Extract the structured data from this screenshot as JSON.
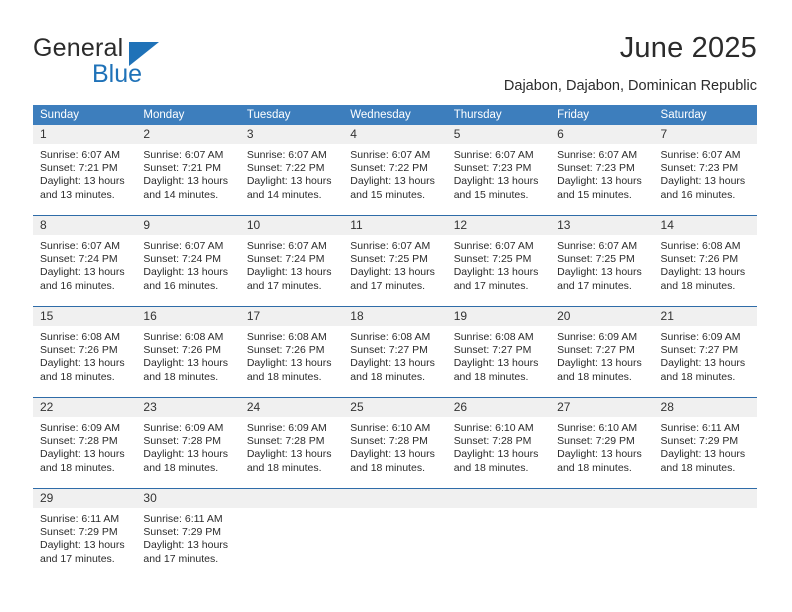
{
  "brand": {
    "name_part1": "General",
    "name_part2": "Blue",
    "accent_color": "#1f72b8",
    "triangle_icon": "triangle-icon"
  },
  "header": {
    "title": "June 2025",
    "subtitle": "Dajabon, Dajabon, Dominican Republic"
  },
  "calendar": {
    "header_bg": "#3d7ebd",
    "daynum_band_bg": "#f0f0f0",
    "row_divider_color": "#2f6ca8",
    "columns": [
      "Sunday",
      "Monday",
      "Tuesday",
      "Wednesday",
      "Thursday",
      "Friday",
      "Saturday"
    ],
    "weeks": [
      [
        {
          "day": "1",
          "sunrise": "Sunrise: 6:07 AM",
          "sunset": "Sunset: 7:21 PM",
          "daylight": "Daylight: 13 hours and 13 minutes."
        },
        {
          "day": "2",
          "sunrise": "Sunrise: 6:07 AM",
          "sunset": "Sunset: 7:21 PM",
          "daylight": "Daylight: 13 hours and 14 minutes."
        },
        {
          "day": "3",
          "sunrise": "Sunrise: 6:07 AM",
          "sunset": "Sunset: 7:22 PM",
          "daylight": "Daylight: 13 hours and 14 minutes."
        },
        {
          "day": "4",
          "sunrise": "Sunrise: 6:07 AM",
          "sunset": "Sunset: 7:22 PM",
          "daylight": "Daylight: 13 hours and 15 minutes."
        },
        {
          "day": "5",
          "sunrise": "Sunrise: 6:07 AM",
          "sunset": "Sunset: 7:23 PM",
          "daylight": "Daylight: 13 hours and 15 minutes."
        },
        {
          "day": "6",
          "sunrise": "Sunrise: 6:07 AM",
          "sunset": "Sunset: 7:23 PM",
          "daylight": "Daylight: 13 hours and 15 minutes."
        },
        {
          "day": "7",
          "sunrise": "Sunrise: 6:07 AM",
          "sunset": "Sunset: 7:23 PM",
          "daylight": "Daylight: 13 hours and 16 minutes."
        }
      ],
      [
        {
          "day": "8",
          "sunrise": "Sunrise: 6:07 AM",
          "sunset": "Sunset: 7:24 PM",
          "daylight": "Daylight: 13 hours and 16 minutes."
        },
        {
          "day": "9",
          "sunrise": "Sunrise: 6:07 AM",
          "sunset": "Sunset: 7:24 PM",
          "daylight": "Daylight: 13 hours and 16 minutes."
        },
        {
          "day": "10",
          "sunrise": "Sunrise: 6:07 AM",
          "sunset": "Sunset: 7:24 PM",
          "daylight": "Daylight: 13 hours and 17 minutes."
        },
        {
          "day": "11",
          "sunrise": "Sunrise: 6:07 AM",
          "sunset": "Sunset: 7:25 PM",
          "daylight": "Daylight: 13 hours and 17 minutes."
        },
        {
          "day": "12",
          "sunrise": "Sunrise: 6:07 AM",
          "sunset": "Sunset: 7:25 PM",
          "daylight": "Daylight: 13 hours and 17 minutes."
        },
        {
          "day": "13",
          "sunrise": "Sunrise: 6:07 AM",
          "sunset": "Sunset: 7:25 PM",
          "daylight": "Daylight: 13 hours and 17 minutes."
        },
        {
          "day": "14",
          "sunrise": "Sunrise: 6:08 AM",
          "sunset": "Sunset: 7:26 PM",
          "daylight": "Daylight: 13 hours and 18 minutes."
        }
      ],
      [
        {
          "day": "15",
          "sunrise": "Sunrise: 6:08 AM",
          "sunset": "Sunset: 7:26 PM",
          "daylight": "Daylight: 13 hours and 18 minutes."
        },
        {
          "day": "16",
          "sunrise": "Sunrise: 6:08 AM",
          "sunset": "Sunset: 7:26 PM",
          "daylight": "Daylight: 13 hours and 18 minutes."
        },
        {
          "day": "17",
          "sunrise": "Sunrise: 6:08 AM",
          "sunset": "Sunset: 7:26 PM",
          "daylight": "Daylight: 13 hours and 18 minutes."
        },
        {
          "day": "18",
          "sunrise": "Sunrise: 6:08 AM",
          "sunset": "Sunset: 7:27 PM",
          "daylight": "Daylight: 13 hours and 18 minutes."
        },
        {
          "day": "19",
          "sunrise": "Sunrise: 6:08 AM",
          "sunset": "Sunset: 7:27 PM",
          "daylight": "Daylight: 13 hours and 18 minutes."
        },
        {
          "day": "20",
          "sunrise": "Sunrise: 6:09 AM",
          "sunset": "Sunset: 7:27 PM",
          "daylight": "Daylight: 13 hours and 18 minutes."
        },
        {
          "day": "21",
          "sunrise": "Sunrise: 6:09 AM",
          "sunset": "Sunset: 7:27 PM",
          "daylight": "Daylight: 13 hours and 18 minutes."
        }
      ],
      [
        {
          "day": "22",
          "sunrise": "Sunrise: 6:09 AM",
          "sunset": "Sunset: 7:28 PM",
          "daylight": "Daylight: 13 hours and 18 minutes."
        },
        {
          "day": "23",
          "sunrise": "Sunrise: 6:09 AM",
          "sunset": "Sunset: 7:28 PM",
          "daylight": "Daylight: 13 hours and 18 minutes."
        },
        {
          "day": "24",
          "sunrise": "Sunrise: 6:09 AM",
          "sunset": "Sunset: 7:28 PM",
          "daylight": "Daylight: 13 hours and 18 minutes."
        },
        {
          "day": "25",
          "sunrise": "Sunrise: 6:10 AM",
          "sunset": "Sunset: 7:28 PM",
          "daylight": "Daylight: 13 hours and 18 minutes."
        },
        {
          "day": "26",
          "sunrise": "Sunrise: 6:10 AM",
          "sunset": "Sunset: 7:28 PM",
          "daylight": "Daylight: 13 hours and 18 minutes."
        },
        {
          "day": "27",
          "sunrise": "Sunrise: 6:10 AM",
          "sunset": "Sunset: 7:29 PM",
          "daylight": "Daylight: 13 hours and 18 minutes."
        },
        {
          "day": "28",
          "sunrise": "Sunrise: 6:11 AM",
          "sunset": "Sunset: 7:29 PM",
          "daylight": "Daylight: 13 hours and 18 minutes."
        }
      ],
      [
        {
          "day": "29",
          "sunrise": "Sunrise: 6:11 AM",
          "sunset": "Sunset: 7:29 PM",
          "daylight": "Daylight: 13 hours and 17 minutes."
        },
        {
          "day": "30",
          "sunrise": "Sunrise: 6:11 AM",
          "sunset": "Sunset: 7:29 PM",
          "daylight": "Daylight: 13 hours and 17 minutes."
        },
        {
          "day": "",
          "sunrise": "",
          "sunset": "",
          "daylight": ""
        },
        {
          "day": "",
          "sunrise": "",
          "sunset": "",
          "daylight": ""
        },
        {
          "day": "",
          "sunrise": "",
          "sunset": "",
          "daylight": ""
        },
        {
          "day": "",
          "sunrise": "",
          "sunset": "",
          "daylight": ""
        },
        {
          "day": "",
          "sunrise": "",
          "sunset": "",
          "daylight": ""
        }
      ]
    ]
  }
}
